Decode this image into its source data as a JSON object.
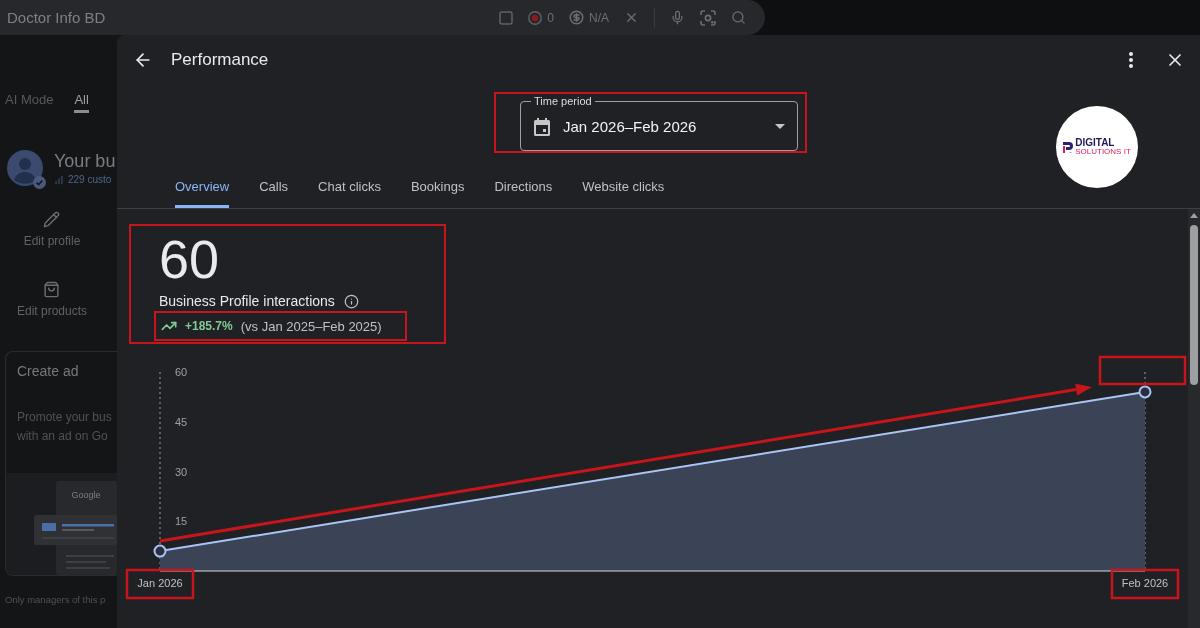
{
  "search_bar": {
    "query": "Doctor Info BD",
    "tools": [
      {
        "kind": "checkbox",
        "checked": false
      },
      {
        "kind": "record",
        "count": "0"
      },
      {
        "kind": "coin",
        "value": "N/A"
      },
      {
        "kind": "clear"
      },
      {
        "kind": "mic"
      },
      {
        "kind": "lens"
      },
      {
        "kind": "search"
      }
    ]
  },
  "background_page": {
    "tabs": [
      {
        "label": "AI Mode",
        "selected": false
      },
      {
        "label": "All",
        "selected": true
      }
    ],
    "business": {
      "name": "Your bu",
      "customers": "229 custo",
      "verified": true
    },
    "actions": [
      {
        "kind": "edit",
        "label": "Edit profile"
      },
      {
        "kind": "products",
        "label": "Edit products"
      }
    ],
    "ad_card": {
      "title": "Create ad",
      "body": [
        "Promote your bus",
        "with an ad on Go"
      ],
      "preview_label": "Google"
    },
    "footnote": "Only managers of this p"
  },
  "performance": {
    "title": "Performance",
    "time_period": {
      "label": "Time period",
      "value": "Jan 2026–Feb 2026",
      "highlighted": true
    },
    "logo": {
      "name": "DIGITAL",
      "tagline": "SOLUTIONS IT"
    },
    "tabs": [
      {
        "label": "Overview",
        "selected": true
      },
      {
        "label": "Calls",
        "selected": false
      },
      {
        "label": "Chat clicks",
        "selected": false
      },
      {
        "label": "Bookings",
        "selected": false
      },
      {
        "label": "Directions",
        "selected": false
      },
      {
        "label": "Website clicks",
        "selected": false
      }
    ],
    "stat": {
      "value": "60",
      "label": "Business Profile interactions",
      "highlighted": true,
      "change": {
        "rising": true,
        "percent": "+185.7%",
        "comparison": "(vs Jan 2025–Feb 2025)",
        "highlighted": true
      }
    },
    "chart": {
      "markup": {
        "trend_arrow": true,
        "empty_frame": true,
        "x_labels_framed": true
      },
      "chart_data": {
        "type": "area",
        "categories": [
          "Jan 2026",
          "Feb 2026"
        ],
        "values": [
          6,
          54
        ],
        "ylim": [
          0,
          60
        ],
        "yticks": [
          15,
          30,
          45,
          60
        ]
      }
    }
  }
}
